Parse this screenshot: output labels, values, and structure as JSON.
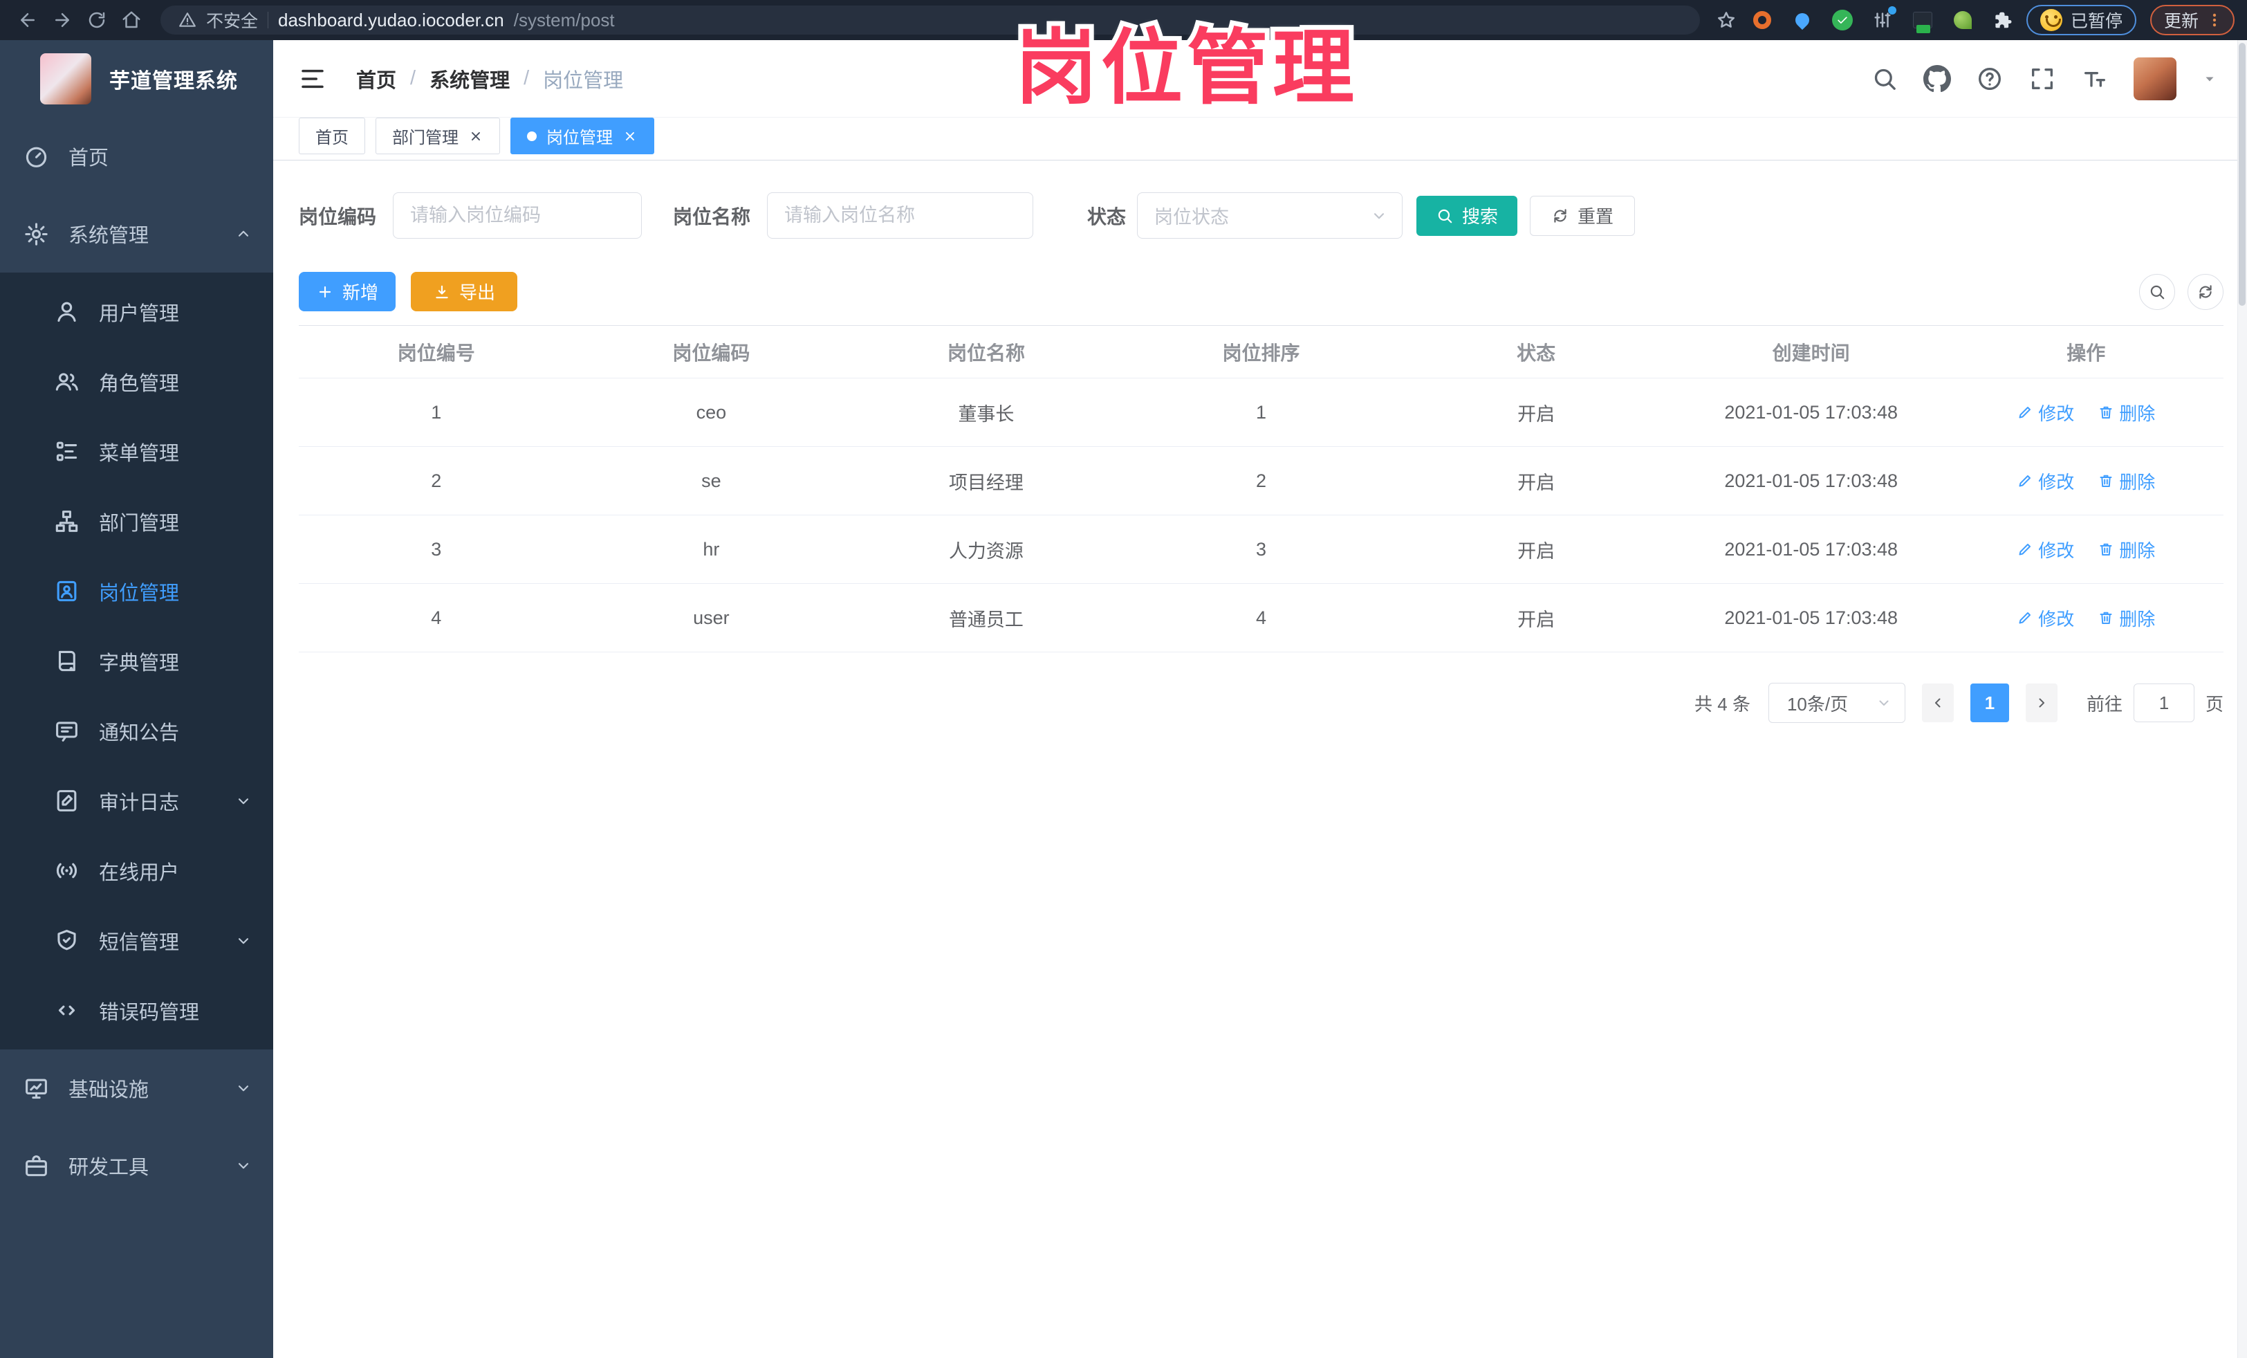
{
  "browser": {
    "security_label": "不安全",
    "url_domain": "dashboard.yudao.iocoder.cn",
    "url_path": "/system/post",
    "paused_label": "已暂停",
    "update_label": "更新"
  },
  "annotation": {
    "text": "岗位管理",
    "color": "#fa3c5f"
  },
  "sidebar": {
    "logo_title": "芋道管理系统",
    "menu": [
      {
        "key": "home",
        "label": "首页",
        "icon": "dashboard-icon",
        "level": "top",
        "arrow": null,
        "active": false
      },
      {
        "key": "system",
        "label": "系统管理",
        "icon": "gear-icon",
        "level": "top",
        "arrow": "up",
        "active": false
      },
      {
        "key": "user",
        "label": "用户管理",
        "icon": "user-icon",
        "level": "sub",
        "arrow": null,
        "active": false
      },
      {
        "key": "role",
        "label": "角色管理",
        "icon": "users-icon",
        "level": "sub",
        "arrow": null,
        "active": false
      },
      {
        "key": "menu",
        "label": "菜单管理",
        "icon": "menu-list-icon",
        "level": "sub",
        "arrow": null,
        "active": false
      },
      {
        "key": "dept",
        "label": "部门管理",
        "icon": "org-tree-icon",
        "level": "sub",
        "arrow": null,
        "active": false
      },
      {
        "key": "post",
        "label": "岗位管理",
        "icon": "post-badge-icon",
        "level": "sub",
        "arrow": null,
        "active": true
      },
      {
        "key": "dict",
        "label": "字典管理",
        "icon": "dict-book-icon",
        "level": "sub",
        "arrow": null,
        "active": false
      },
      {
        "key": "notice",
        "label": "通知公告",
        "icon": "announcement-icon",
        "level": "sub",
        "arrow": null,
        "active": false
      },
      {
        "key": "audit-log",
        "label": "审计日志",
        "icon": "audit-log-icon",
        "level": "sub",
        "arrow": "down",
        "active": false
      },
      {
        "key": "online-user",
        "label": "在线用户",
        "icon": "online-signal-icon",
        "level": "sub",
        "arrow": null,
        "active": false
      },
      {
        "key": "sms",
        "label": "短信管理",
        "icon": "sms-shield-icon",
        "level": "sub",
        "arrow": "down",
        "active": false
      },
      {
        "key": "error-code",
        "label": "错误码管理",
        "icon": "error-code-icon",
        "level": "sub",
        "arrow": null,
        "active": false
      },
      {
        "key": "infrastructure",
        "label": "基础设施",
        "icon": "infrastructure-icon",
        "level": "top",
        "arrow": "down",
        "active": false
      },
      {
        "key": "dev-tools",
        "label": "研发工具",
        "icon": "dev-tools-icon",
        "level": "top",
        "arrow": "down",
        "active": false
      }
    ]
  },
  "header": {
    "breadcrumb": [
      "首页",
      "系统管理",
      "岗位管理"
    ]
  },
  "tabs": [
    {
      "label": "首页",
      "closable": false,
      "active": false
    },
    {
      "label": "部门管理",
      "closable": true,
      "active": false
    },
    {
      "label": "岗位管理",
      "closable": true,
      "active": true
    }
  ],
  "filters": {
    "post_code": {
      "label": "岗位编码",
      "placeholder": "请输入岗位编码"
    },
    "post_name": {
      "label": "岗位名称",
      "placeholder": "请输入岗位名称"
    },
    "status": {
      "label": "状态",
      "placeholder": "岗位状态"
    },
    "search_button": "搜索",
    "reset_button": "重置"
  },
  "toolbar": {
    "add_button": "新增",
    "export_button": "导出"
  },
  "table": {
    "columns": [
      "岗位编号",
      "岗位编码",
      "岗位名称",
      "岗位排序",
      "状态",
      "创建时间",
      "操作"
    ],
    "rows": [
      {
        "id": "1",
        "code": "ceo",
        "name": "董事长",
        "sort": "1",
        "status": "开启",
        "created": "2021-01-05 17:03:48"
      },
      {
        "id": "2",
        "code": "se",
        "name": "项目经理",
        "sort": "2",
        "status": "开启",
        "created": "2021-01-05 17:03:48"
      },
      {
        "id": "3",
        "code": "hr",
        "name": "人力资源",
        "sort": "3",
        "status": "开启",
        "created": "2021-01-05 17:03:48"
      },
      {
        "id": "4",
        "code": "user",
        "name": "普通员工",
        "sort": "4",
        "status": "开启",
        "created": "2021-01-05 17:03:48"
      }
    ],
    "edit_label": "修改",
    "delete_label": "删除"
  },
  "pagination": {
    "total_text": "共 4 条",
    "page_size": "10条/页",
    "current_page": "1",
    "goto_label": "前往",
    "goto_value": "1",
    "page_unit": "页"
  },
  "colors": {
    "primary": "#409eff",
    "search_teal": "#17b3a3",
    "export_orange": "#f0a020",
    "annotation_pink": "#fa3c5f",
    "sidebar_bg": "#304156",
    "submenu_bg": "#1f2d3d",
    "browser_bar_bg": "#1c2431",
    "link_blue": "#409eff"
  }
}
